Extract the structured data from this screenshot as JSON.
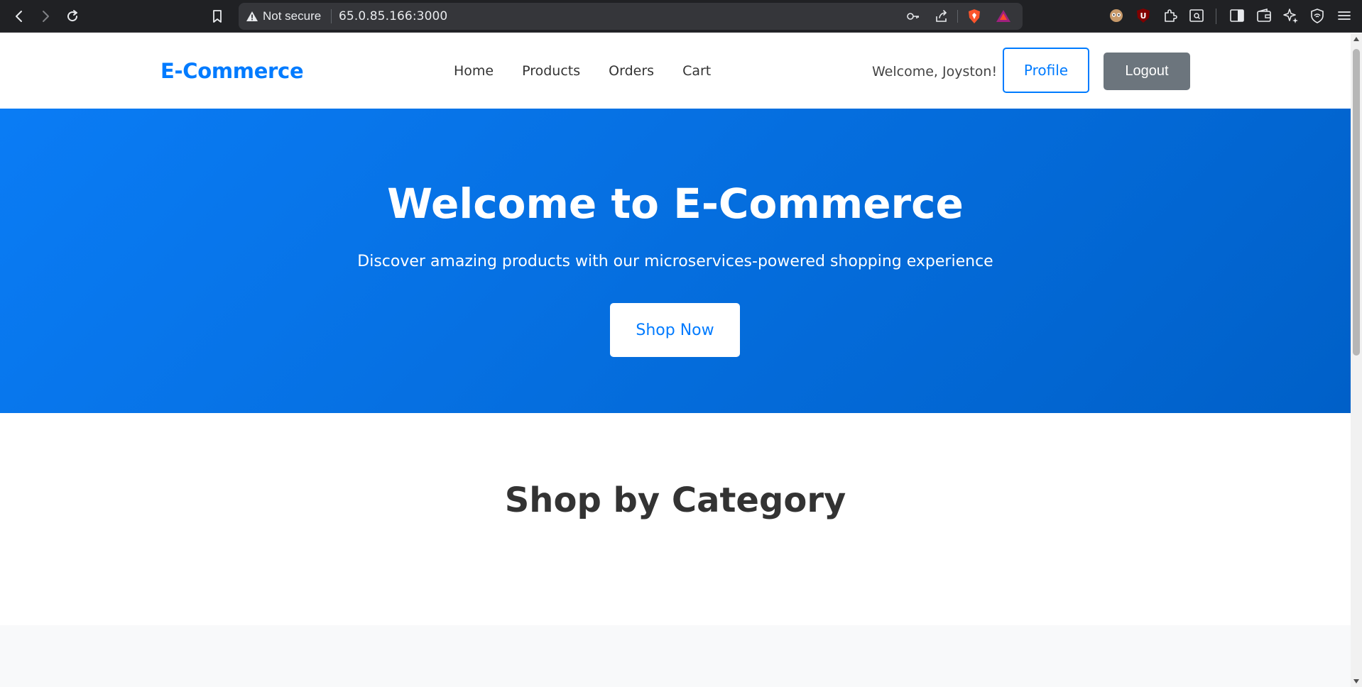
{
  "browser": {
    "security_label": "Not secure",
    "url": "65.0.85.166:3000",
    "icons": [
      "back-icon",
      "forward-icon",
      "reload-icon",
      "bookmark-icon",
      "warning-icon",
      "key-icon",
      "share-icon",
      "brave-shields-icon",
      "brave-rewards-icon",
      "extension-avatar-icon",
      "ublock-icon",
      "extensions-icon",
      "page-search-icon",
      "sidebar-icon",
      "wallet-icon",
      "leo-ai-icon",
      "vpn-icon",
      "menu-icon"
    ],
    "colors": {
      "chrome_bg": "#202124",
      "urlbar_bg": "#35363a"
    }
  },
  "header": {
    "brand": "E-Commerce",
    "nav": [
      "Home",
      "Products",
      "Orders",
      "Cart"
    ],
    "welcome": "Welcome, Joyston!",
    "profile_label": "Profile",
    "logout_label": "Logout"
  },
  "hero": {
    "title": "Welcome to E-Commerce",
    "subtitle": "Discover amazing products with our microservices-powered shopping experience",
    "cta_label": "Shop Now"
  },
  "categories": {
    "title": "Shop by Category"
  },
  "colors": {
    "accent": "#007bff",
    "logout_bg": "#6c757d",
    "hero_gradient_start": "#0a7cf5",
    "hero_gradient_end": "#0060c8",
    "section_bg": "#f8f9fa"
  }
}
